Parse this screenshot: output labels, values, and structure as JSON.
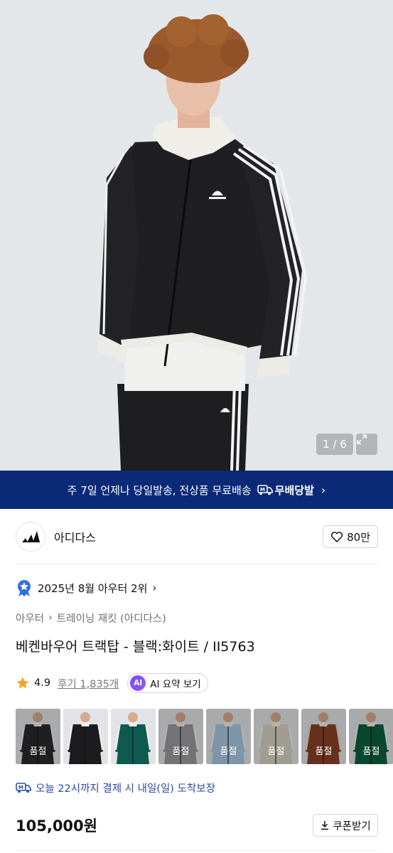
{
  "hero": {
    "counter": "1 / 6"
  },
  "banner": {
    "text": "주 7일 언제나 당일발송, 전상품 무료배송",
    "badge_label": "무배당발"
  },
  "brand": {
    "name": "아디다스",
    "like_count": "80만"
  },
  "ranking": {
    "text": "2025년 8월 아우터 2위"
  },
  "breadcrumb": {
    "level1": "아우터",
    "level2": "트레이닝 재킷 (아디다스)"
  },
  "product": {
    "title": "베켄바우어 트랙탑 - 블랙:화이트 / II5763",
    "rating": "4.9",
    "review_label": "후기 1,835개",
    "ai_badge": "AI",
    "ai_summary_label": "AI 요약 보기",
    "price": "105,000원",
    "coupon_label": "쿠폰받기"
  },
  "variants": [
    {
      "color": "#2a2a2c",
      "stripe": "#f2f2f2",
      "soldout": "품절",
      "selected": true
    },
    {
      "color": "#1c1c1e",
      "stripe": "#f2f2f2",
      "soldout": "",
      "selected": false
    },
    {
      "color": "#0f5a4e",
      "stripe": "#f2f2f2",
      "soldout": "",
      "selected": false
    },
    {
      "color": "#9a9a9c",
      "stripe": "#f2f2f2",
      "soldout": "품절",
      "selected": false
    },
    {
      "color": "#a9c6e0",
      "stripe": "#f2f2f2",
      "soldout": "품절",
      "selected": false
    },
    {
      "color": "#d6d0c2",
      "stripe": "#f2f2f2",
      "soldout": "품절",
      "selected": false
    },
    {
      "color": "#8a4127",
      "stripe": "#e8d9c4",
      "soldout": "품절",
      "selected": false
    },
    {
      "color": "#0d5e3e",
      "stripe": "#f2f2f2",
      "soldout": "품절",
      "selected": false
    }
  ],
  "guarantee": {
    "text": "오늘 22시까지 결제 시 내일(일) 도착보장"
  },
  "colors": {
    "banner_bg": "#0a2a78",
    "guarantee_text": "#2a4aa8",
    "ai_gradient": "#6f46ff"
  }
}
